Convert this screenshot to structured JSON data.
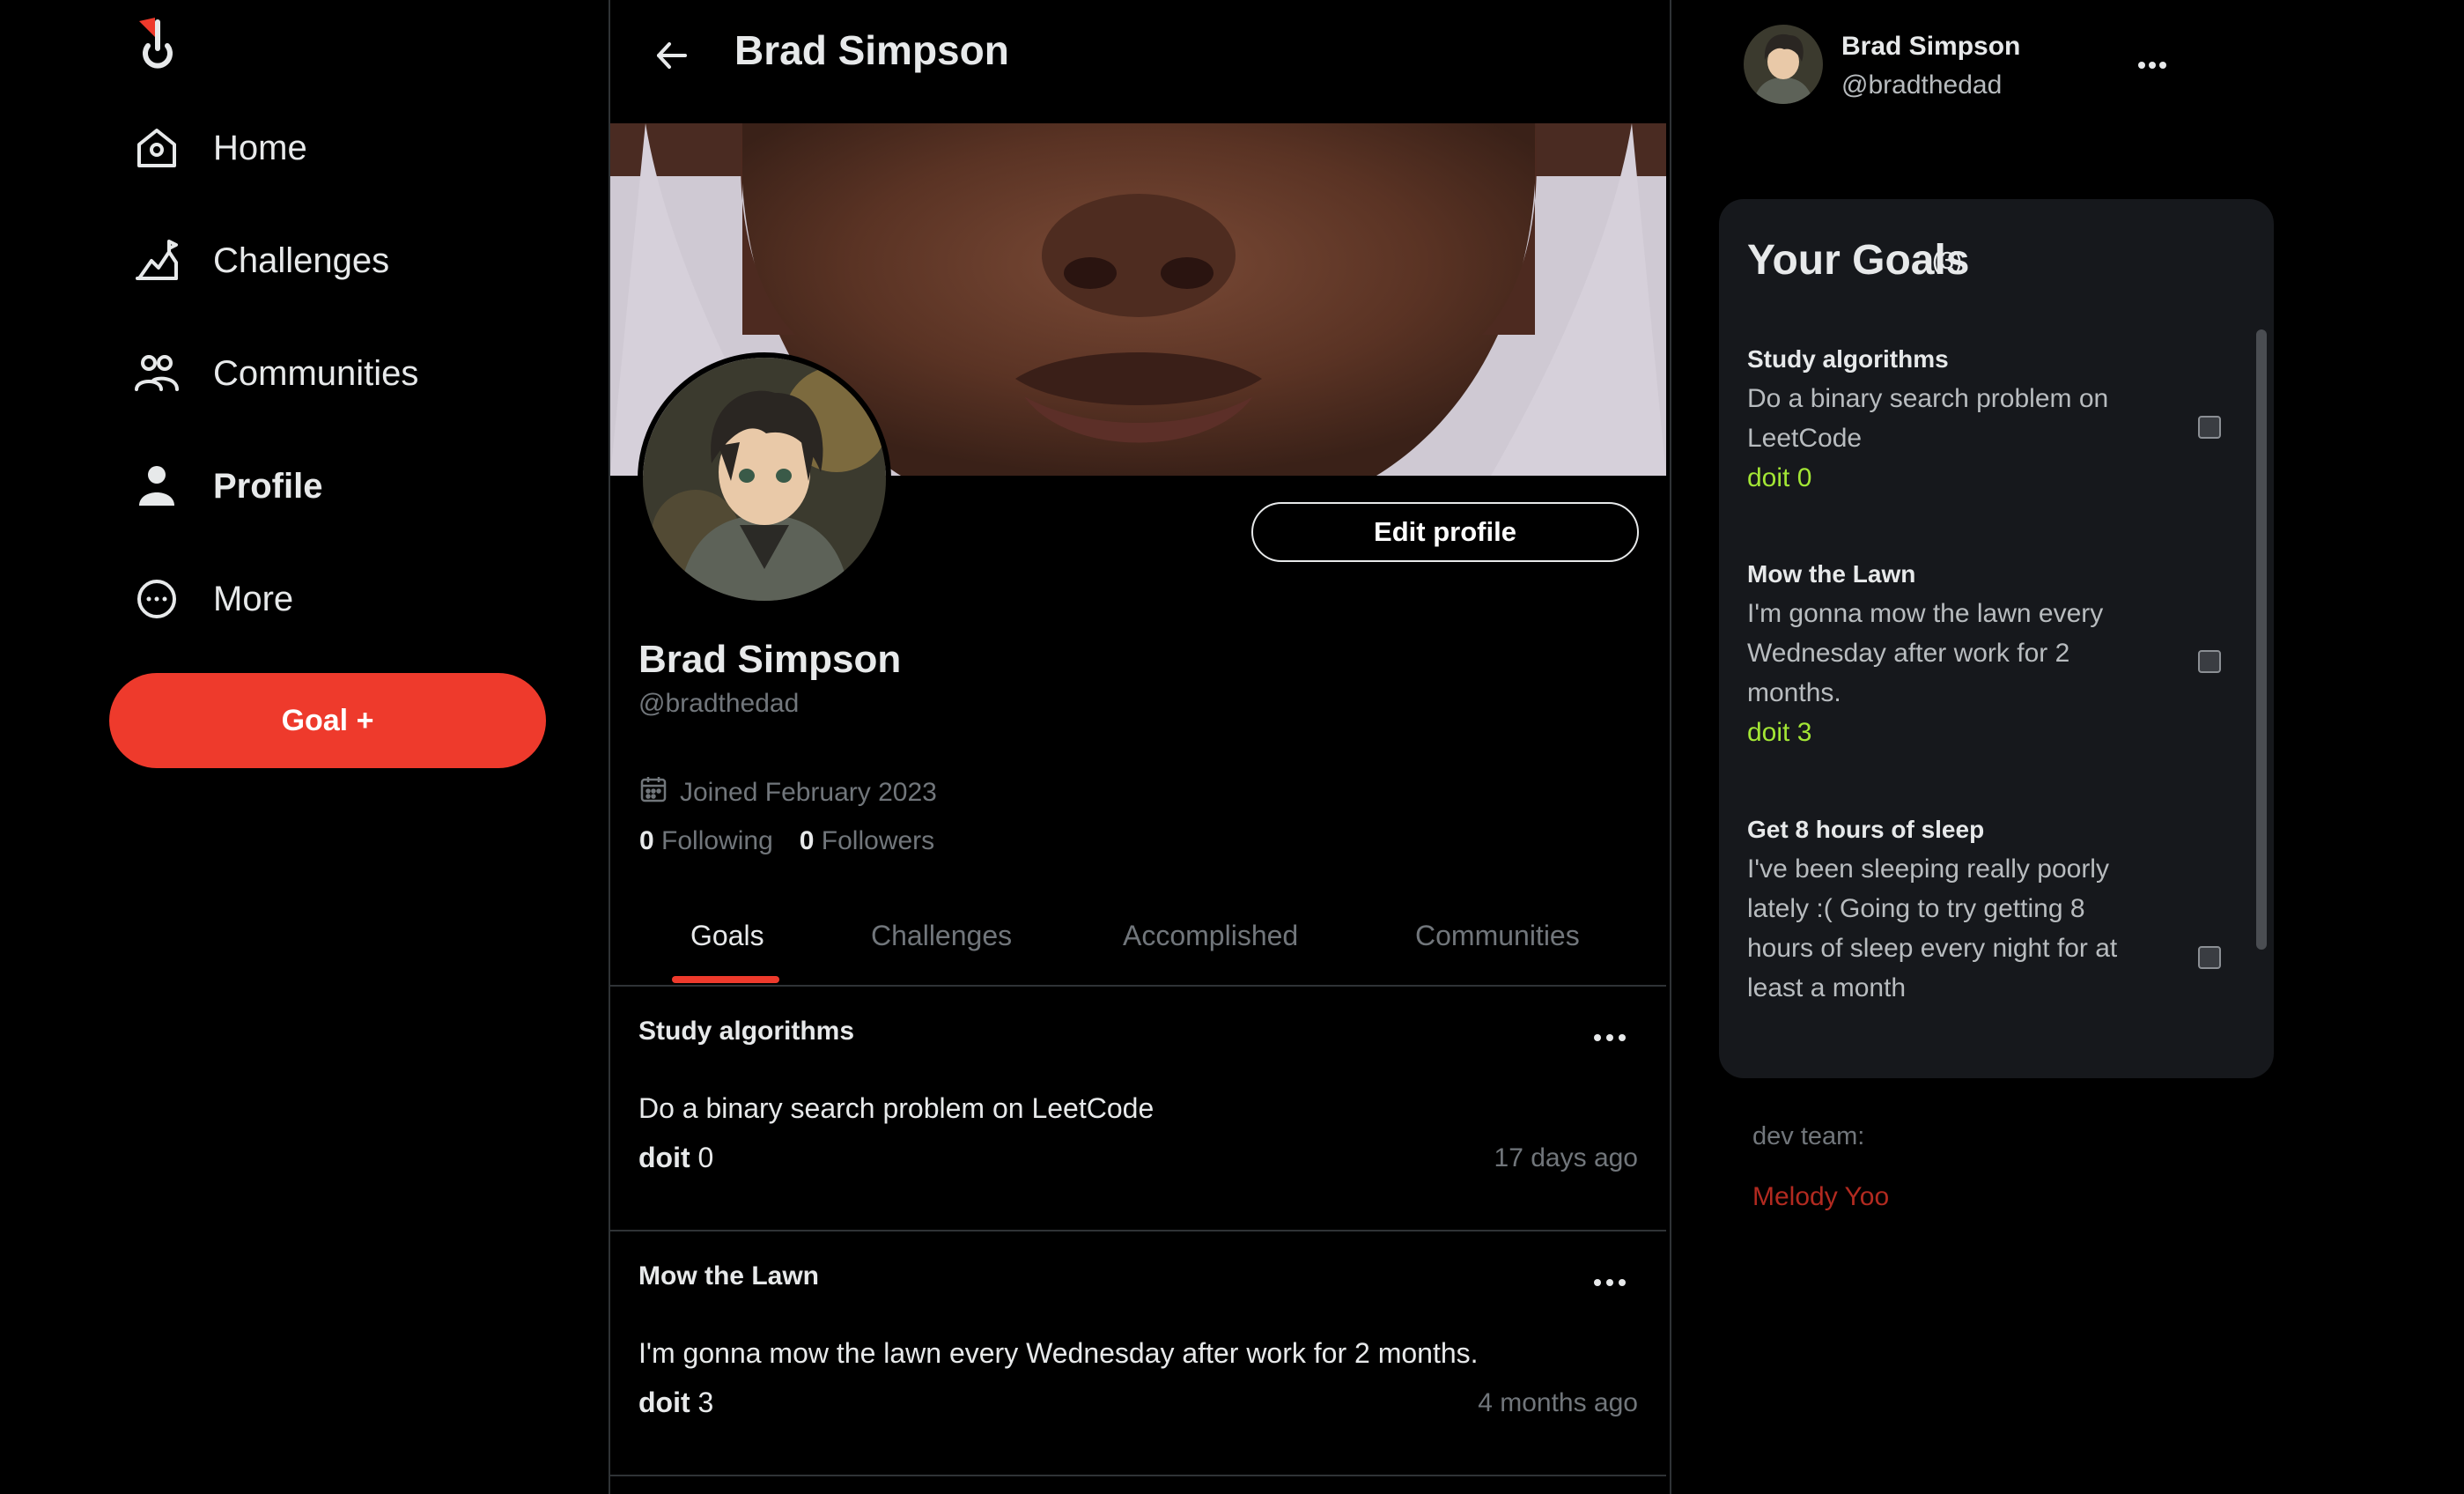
{
  "nav": {
    "items": [
      {
        "label": "Home",
        "icon": "home-icon"
      },
      {
        "label": "Challenges",
        "icon": "challenges-icon"
      },
      {
        "label": "Communities",
        "icon": "communities-icon"
      },
      {
        "label": "Profile",
        "icon": "profile-icon"
      },
      {
        "label": "More",
        "icon": "more-circle-icon"
      }
    ],
    "goal_button": "Goal +"
  },
  "header": {
    "title": "Brad Simpson"
  },
  "profile": {
    "name": "Brad Simpson",
    "handle": "@bradthedad",
    "edit_button": "Edit profile",
    "joined": "Joined February 2023",
    "following_count": "0",
    "following_label": "Following",
    "followers_count": "0",
    "followers_label": "Followers"
  },
  "tabs": [
    "Goals",
    "Challenges",
    "Accomplished",
    "Communities"
  ],
  "posts": [
    {
      "title": "Study algorithms",
      "body": "Do a binary search problem on LeetCode",
      "doit_label": "doit",
      "doit_count": "0",
      "time": "17 days ago"
    },
    {
      "title": "Mow the Lawn",
      "body": "I'm gonna mow the lawn every Wednesday after work for 2 months.",
      "doit_label": "doit",
      "doit_count": "3",
      "time": "4 months ago"
    }
  ],
  "account": {
    "name": "Brad Simpson",
    "handle": "@bradthedad"
  },
  "goals_panel": {
    "title": "Your Goals",
    "count": "(3)",
    "items": [
      {
        "title": "Study algorithms",
        "desc": "Do a binary search problem on LeetCode",
        "doit": "doit 0"
      },
      {
        "title": "Mow the Lawn",
        "desc": "I'm gonna mow the lawn every Wednesday after work for 2 months.",
        "doit": "doit 3"
      },
      {
        "title": "Get 8 hours of sleep",
        "desc": "I've been sleeping really poorly lately :( Going to try getting 8 hours of sleep every night for at least a month",
        "doit": ""
      }
    ]
  },
  "dev_team": {
    "label": "dev team:",
    "name": "Melody Yoo"
  },
  "colors": {
    "accent": "#ee3a2c",
    "doit_green": "#a3e635",
    "dev_name": "#b22a20"
  }
}
